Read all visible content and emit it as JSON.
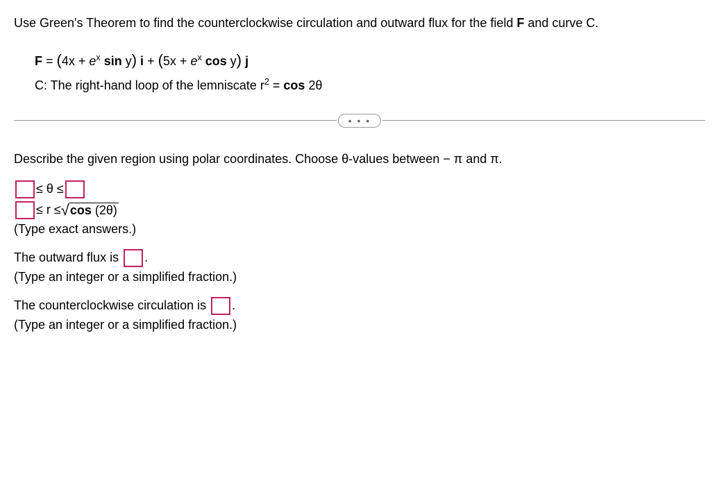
{
  "problem": {
    "intro_prefix": "Use ",
    "intro_greens": "Green's",
    "intro_mid": " Theorem to find the counterclockwise circulation and outward flux for the field ",
    "intro_F": "F",
    "intro_end": " and curve C."
  },
  "equation": {
    "F_label": "F",
    "F_eq": " = ",
    "F_part1_open": "(",
    "F_part1a": "4x + ",
    "F_e1": "e",
    "F_x1": "x",
    "F_sin": " sin",
    "F_y1": " y",
    "F_part1_close": ")",
    "F_i": " i",
    "F_plus": " + ",
    "F_part2_open": "(",
    "F_part2a": "5x + ",
    "F_e2": "e",
    "F_x2": "x",
    "F_cos": " cos",
    "F_y2": " y",
    "F_part2_close": ")",
    "F_j": " j",
    "C_label": "C: The ",
    "C_rh": "right-hand",
    "C_mid": " loop of the lemniscate r",
    "C_exp": "2",
    "C_eq": " = ",
    "C_cos": "cos",
    "C_arg": " 2θ"
  },
  "divider_dots": "• • •",
  "instruction_text": {
    "prefix": "Describe the given region using polar coordinates. Choose θ-",
    "values": "values",
    "mid": " between  − π and π."
  },
  "inequality": {
    "theta_le1": " ≤ θ ≤ ",
    "r_le1": " ≤ r ≤ ",
    "cos_label": "cos",
    "cos_arg": " (2θ)"
  },
  "hint1": "(Type exact answers.)",
  "flux": {
    "label_pre": "The outward flux is ",
    "label_post": "."
  },
  "hint2": "(Type an integer or a simplified fraction.)",
  "circ": {
    "label_pre": "The counterclockwise circulation is ",
    "label_post": "."
  },
  "hint3": "(Type an integer or a simplified fraction.)"
}
